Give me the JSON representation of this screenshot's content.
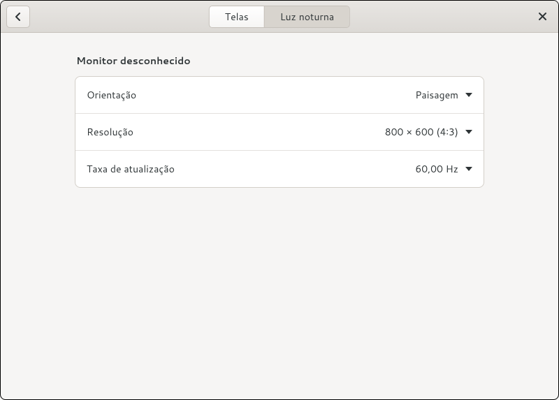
{
  "header": {
    "tabs": [
      {
        "label": "Telas",
        "active": true
      },
      {
        "label": "Luz noturna",
        "active": false
      }
    ]
  },
  "section": {
    "title": "Monitor desconhecido"
  },
  "rows": {
    "orientation": {
      "label": "Orientação",
      "value": "Paisagem"
    },
    "resolution": {
      "label": "Resolução",
      "value": "800 × 600 (4∶3)"
    },
    "refresh": {
      "label": "Taxa de atualização",
      "value": "60,00 Hz"
    }
  }
}
